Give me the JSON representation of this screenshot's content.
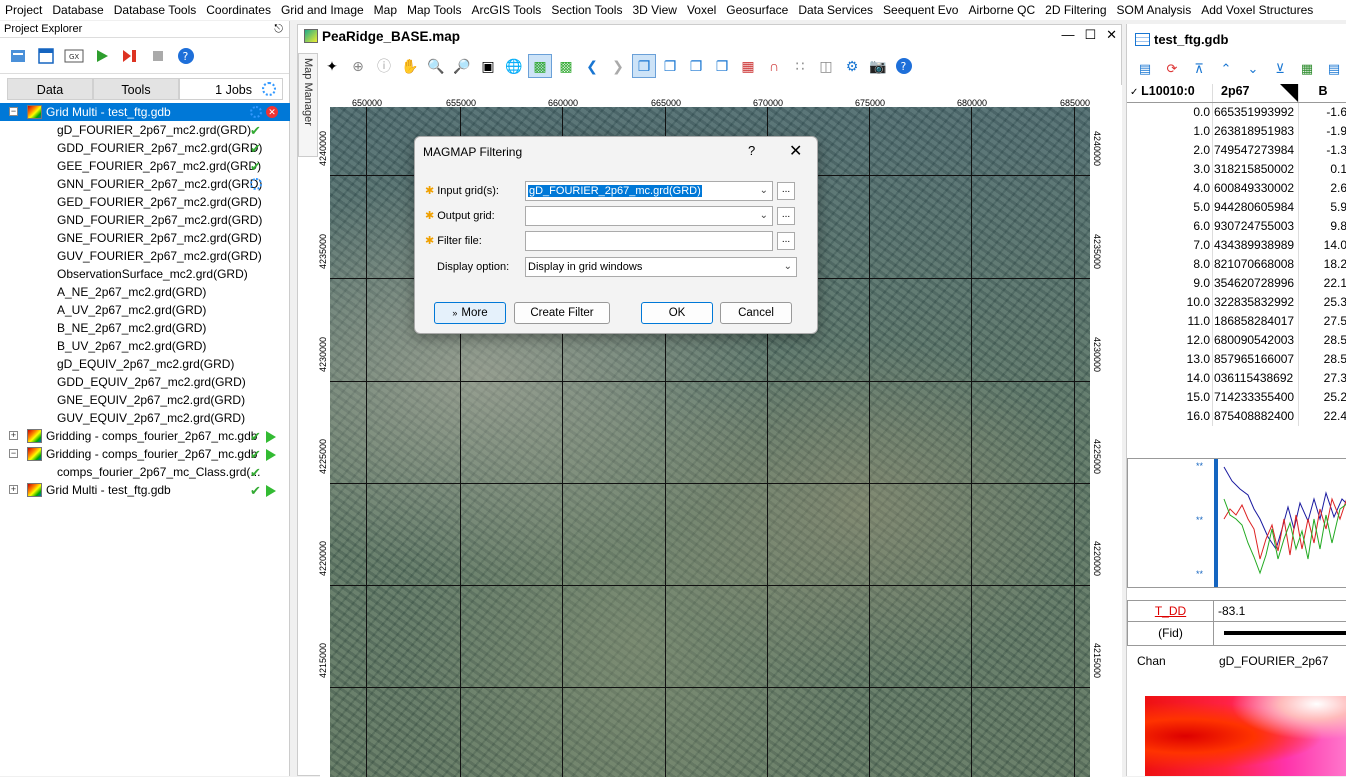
{
  "menu": [
    "Project",
    "Database",
    "Database Tools",
    "Coordinates",
    "Grid and Image",
    "Map",
    "Map Tools",
    "ArcGIS Tools",
    "Section Tools",
    "3D View",
    "Voxel",
    "Geosurface",
    "Data Services",
    "Seequent Evo",
    "Airborne QC",
    "2D Filtering",
    "SOM Analysis",
    "Add Voxel Structures"
  ],
  "explorer": {
    "title": "Project Explorer",
    "tabs": [
      "Data",
      "Tools",
      "1 Jobs"
    ],
    "tree": [
      {
        "label": "Grid Multi - test_ftg.gdb",
        "level": 0,
        "expander": "−",
        "status": "spin",
        "selected": true,
        "close": true
      },
      {
        "label": "gD_FOURIER_2p67_mc2.grd(GRD)",
        "level": 1,
        "status": "check"
      },
      {
        "label": "GDD_FOURIER_2p67_mc2.grd(GRD)",
        "level": 1,
        "status": "check"
      },
      {
        "label": "GEE_FOURIER_2p67_mc2.grd(GRD)",
        "level": 1,
        "status": "check"
      },
      {
        "label": "GNN_FOURIER_2p67_mc2.grd(GRD)",
        "level": 1,
        "status": "spin"
      },
      {
        "label": "GED_FOURIER_2p67_mc2.grd(GRD)",
        "level": 1,
        "status": ""
      },
      {
        "label": "GND_FOURIER_2p67_mc2.grd(GRD)",
        "level": 1,
        "status": ""
      },
      {
        "label": "GNE_FOURIER_2p67_mc2.grd(GRD)",
        "level": 1,
        "status": ""
      },
      {
        "label": "GUV_FOURIER_2p67_mc2.grd(GRD)",
        "level": 1,
        "status": ""
      },
      {
        "label": "ObservationSurface_mc2.grd(GRD)",
        "level": 1,
        "status": ""
      },
      {
        "label": "A_NE_2p67_mc2.grd(GRD)",
        "level": 1,
        "status": ""
      },
      {
        "label": "A_UV_2p67_mc2.grd(GRD)",
        "level": 1,
        "status": ""
      },
      {
        "label": "B_NE_2p67_mc2.grd(GRD)",
        "level": 1,
        "status": ""
      },
      {
        "label": "B_UV_2p67_mc2.grd(GRD)",
        "level": 1,
        "status": ""
      },
      {
        "label": "gD_EQUIV_2p67_mc2.grd(GRD)",
        "level": 1,
        "status": ""
      },
      {
        "label": "GDD_EQUIV_2p67_mc2.grd(GRD)",
        "level": 1,
        "status": ""
      },
      {
        "label": "GNE_EQUIV_2p67_mc2.grd(GRD)",
        "level": 1,
        "status": ""
      },
      {
        "label": "GUV_EQUIV_2p67_mc2.grd(GRD)",
        "level": 1,
        "status": ""
      },
      {
        "label": "Gridding - comps_fourier_2p67_mc.gdb",
        "level": 0,
        "expander": "+",
        "status": "checkplay"
      },
      {
        "label": "Gridding - comps_fourier_2p67_mc.gdb",
        "level": 0,
        "expander": "−",
        "status": "checkplay"
      },
      {
        "label": "comps_fourier_2p67_mc_Class.grd(...",
        "level": 1,
        "status": "check"
      },
      {
        "label": "Grid Multi - test_ftg.gdb",
        "level": 0,
        "expander": "+",
        "status": "checkplay"
      }
    ]
  },
  "map": {
    "title": "PeaRidge_BASE.map",
    "manager_label": "Map Manager",
    "x_ticks": [
      "650000",
      "655000",
      "660000",
      "665000",
      "670000",
      "675000",
      "680000",
      "685000"
    ],
    "y_ticks": [
      "4240000",
      "4235000",
      "4230000",
      "4225000",
      "4220000",
      "4215000"
    ]
  },
  "dialog": {
    "title": "MAGMAP Filtering",
    "help": "?",
    "input_label": "Input grid(s):",
    "input_value": "gD_FOURIER_2p67_mc.grd(GRD)",
    "output_label": "Output grid:",
    "output_value": "",
    "filter_label": "Filter file:",
    "filter_value": "",
    "display_label": "Display option:",
    "display_value": "Display in grid windows",
    "more": "More",
    "create_filter": "Create Filter",
    "ok": "OK",
    "cancel": "Cancel",
    "browse": "..."
  },
  "database": {
    "title": "test_ftg.gdb",
    "col0": "L10010:0",
    "col1": "2p67",
    "col2": "B",
    "rows": [
      [
        "0.0",
        "665351993992",
        "-1.6"
      ],
      [
        "1.0",
        "263818951983",
        "-1.9"
      ],
      [
        "2.0",
        "749547273984",
        "-1.3"
      ],
      [
        "3.0",
        "318215850002",
        "0.1"
      ],
      [
        "4.0",
        "600849330002",
        "2.6"
      ],
      [
        "5.0",
        "944280605984",
        "5.9"
      ],
      [
        "6.0",
        "930724755003",
        "9.8"
      ],
      [
        "7.0",
        "434389938989",
        "14.0"
      ],
      [
        "8.0",
        "821070668008",
        "18.2"
      ],
      [
        "9.0",
        "354620728996",
        "22.1"
      ],
      [
        "10.0",
        "322835832992",
        "25.3"
      ],
      [
        "11.0",
        "186858284017",
        "27.5"
      ],
      [
        "12.0",
        "680090542003",
        "28.5"
      ],
      [
        "13.0",
        "857965166007",
        "28.5"
      ],
      [
        "14.0",
        "036115438692",
        "27.3"
      ],
      [
        "15.0",
        "714233355400",
        "25.2"
      ],
      [
        "16.0",
        "875408882400",
        "22.4"
      ]
    ],
    "profile_axis": [
      "**",
      "**",
      "**"
    ],
    "t_dd_label": "T_DD",
    "t_dd_value": "-83.1",
    "fid_label": "(Fid)",
    "chan_label": "Chan",
    "chan_value": "gD_FOURIER_2p67"
  }
}
